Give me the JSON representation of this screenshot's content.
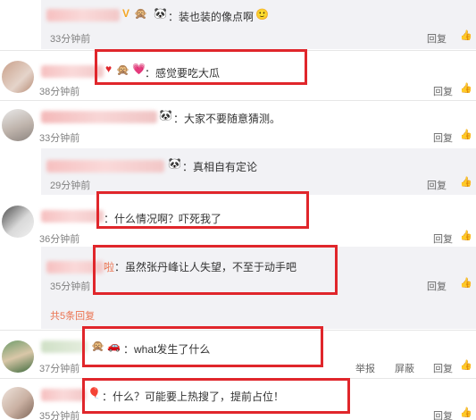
{
  "comments": [
    {
      "text": "：装也装的像点啊",
      "time": "33分钟前",
      "reply": "回复"
    },
    {
      "text": "：感觉要吃大瓜",
      "time": "38分钟前",
      "reply": "回复"
    },
    {
      "text": "：大家不要随意猜测。",
      "time": "33分钟前",
      "reply": "回复"
    },
    {
      "text": "：真相自有定论",
      "time": "29分钟前",
      "reply": "回复"
    },
    {
      "text": "：什么情况啊？吓死我了",
      "time": "36分钟前",
      "reply": "回复"
    },
    {
      "text": "：虽然张丹峰让人失望，不至于动手吧",
      "name_suffix": "啦",
      "time": "35分钟前",
      "reply": "回复"
    },
    {
      "text": "：what发生了什么",
      "time": "37分钟前",
      "report": "举报",
      "block": "屏蔽",
      "reply": "回复"
    },
    {
      "text": "：什么？可能要上热搜了，提前占位！",
      "time": "35分钟前",
      "reply": "回复"
    }
  ],
  "more_replies": "共5条回复",
  "colors": {
    "highlight": "#e0262b",
    "more_link": "#eb7350"
  }
}
